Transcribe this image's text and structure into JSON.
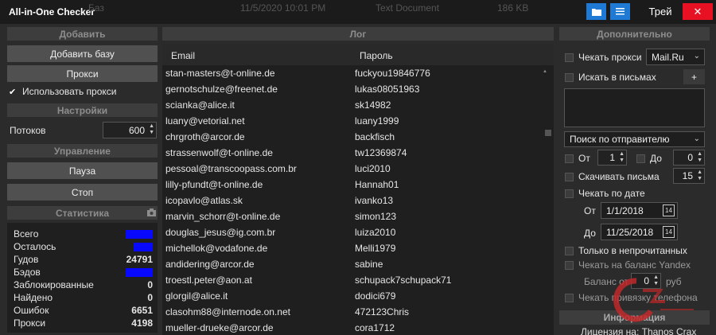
{
  "window": {
    "title": "All-in-One Checker",
    "ghost_text": [
      "Баз",
      "11/5/2020 10:01 PM",
      "Text Document",
      "186 KB"
    ],
    "user_label": "Трей",
    "close_symbol": "✕"
  },
  "left": {
    "add_header": "Добавить",
    "add_base_label": "Добавить базу",
    "proxy_label": "Прокси",
    "use_proxy_label": "Использовать прокси",
    "use_proxy_checked": true,
    "settings_header": "Настройки",
    "threads_label": "Потоков",
    "threads_value": "600",
    "control_header": "Управление",
    "pause_label": "Пауза",
    "stop_label": "Стоп",
    "stats_header": "Статистика",
    "stats": [
      {
        "label": "Всего",
        "value": "",
        "redacted": true
      },
      {
        "label": "Осталось",
        "value": "",
        "redacted": true
      },
      {
        "label": "Гудов",
        "value": "24791",
        "redacted": false
      },
      {
        "label": "Бэдов",
        "value": "",
        "redacted": true
      },
      {
        "label": "Заблокированные",
        "value": "0",
        "redacted": false
      },
      {
        "label": "Найдено",
        "value": "0",
        "redacted": false
      },
      {
        "label": "Ошибок",
        "value": "6651",
        "redacted": false
      },
      {
        "label": "Прокси",
        "value": "4198",
        "redacted": false
      }
    ]
  },
  "log": {
    "header": "Лог",
    "col_email": "Email",
    "col_password": "Пароль",
    "rows": [
      {
        "email": "stan-masters@t-online.de",
        "password": "fuckyou19846776"
      },
      {
        "email": "gernotschulze@freenet.de",
        "password": "lukas08051963"
      },
      {
        "email": "scianka@alice.it",
        "password": "sk14982"
      },
      {
        "email": "luany@vetorial.net",
        "password": "luany1999"
      },
      {
        "email": "chrgroth@arcor.de",
        "password": "backfisch"
      },
      {
        "email": "strassenwolf@t-online.de",
        "password": "tw12369874"
      },
      {
        "email": "pessoal@transcoopass.com.br",
        "password": "luci2010"
      },
      {
        "email": "lilly-pfundt@t-online.de",
        "password": "Hannah01"
      },
      {
        "email": "icopavlo@atlas.sk",
        "password": "ivanko13"
      },
      {
        "email": "marvin_schorr@t-online.de",
        "password": "simon123"
      },
      {
        "email": "douglas_jesus@ig.com.br",
        "password": "luiza2010"
      },
      {
        "email": "michellok@vodafone.de",
        "password": "Melli1979"
      },
      {
        "email": "andidering@arcor.de",
        "password": "sabine"
      },
      {
        "email": "troestl.peter@aon.at",
        "password": "schupack7schupack71"
      },
      {
        "email": "glorgil@alice.it",
        "password": "dodici679"
      },
      {
        "email": "clasohm88@internode.on.net",
        "password": "472123Chris"
      },
      {
        "email": "mueller-drueke@arcor.de",
        "password": "cora1712"
      }
    ]
  },
  "right": {
    "header": "Дополнительно",
    "check_proxy_label": "Чекать прокси",
    "check_proxy_service": "Mail.Ru",
    "search_letters_label": "Искать в письмах",
    "add_symbol": "+",
    "search_mode": "Поиск по отправителю",
    "from_label": "От",
    "from_value": "1",
    "to_label": "До",
    "to_value": "0",
    "download_label": "Скачивать письма",
    "download_value": "15",
    "check_by_date_label": "Чекать по дате",
    "date_from_label": "От",
    "date_from_value": "1/1/2018",
    "date_to_label": "До",
    "date_to_value": "11/25/2018",
    "unread_label": "Только в непрочитанных",
    "yandex_label": "Чекать на баланс Yandex",
    "balance_label": "Баланс от",
    "balance_value": "0",
    "balance_unit": "руб",
    "phone_label": "Чекать привязку телефона",
    "info_header": "Информация",
    "license_text": "Лицензия на: Thanos Crax"
  },
  "colors": {
    "accent": "#1f7ad6",
    "close": "#e81123",
    "redacted": "#0808ff",
    "watermark": "#c0282a"
  },
  "icons": [
    "folder-icon",
    "list-icon",
    "camera-icon",
    "check-icon",
    "calendar-icon",
    "chevron-down-icon",
    "spin-arrows-icon"
  ]
}
